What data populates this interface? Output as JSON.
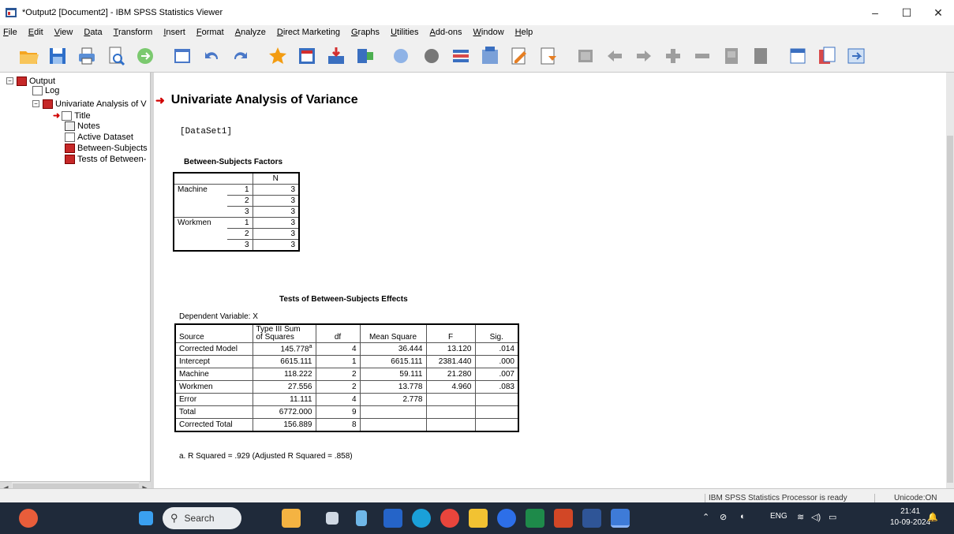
{
  "window": {
    "title": "*Output2 [Document2] - IBM SPSS Statistics Viewer",
    "controls": {
      "minimize": "–",
      "maximize": "☐",
      "close": "✕"
    }
  },
  "menu": [
    "File",
    "Edit",
    "View",
    "Data",
    "Transform",
    "Insert",
    "Format",
    "Analyze",
    "Direct Marketing",
    "Graphs",
    "Utilities",
    "Add-ons",
    "Window",
    "Help"
  ],
  "toolbar_icons": [
    "open-icon",
    "save-icon",
    "print-icon",
    "print-preview-icon",
    "export-icon",
    "recall-dialog-icon",
    "undo-icon",
    "redo-icon",
    "goto-data-icon",
    "goto-case-icon",
    "goto-variable-icon",
    "variables-icon",
    "create-title-icon",
    "create-text-icon",
    "insert-output-icon",
    "designate-window-icon",
    "promote-icon",
    "demote-icon",
    "collapse-icon",
    "back-icon",
    "forward-icon",
    "expand-icon",
    "minus-icon",
    "show-icon",
    "hide-icon",
    "insert-heading-icon",
    "insert-table-icon",
    "select-last-output-icon"
  ],
  "outline": {
    "root": "Output",
    "items": [
      {
        "label": "Log",
        "level": 1
      },
      {
        "label": "Univariate Analysis of V",
        "level": 1
      },
      {
        "label": "Title",
        "level": 2
      },
      {
        "label": "Notes",
        "level": 2
      },
      {
        "label": "Active Dataset",
        "level": 2
      },
      {
        "label": "Between-Subjects",
        "level": 2
      },
      {
        "label": "Tests of Between-",
        "level": 2
      }
    ]
  },
  "content": {
    "heading": "Univariate Analysis of Variance",
    "dataset": "[DataSet1]",
    "bsf": {
      "caption": "Between-Subjects Factors",
      "col_header": "N",
      "rows": [
        {
          "factor": "Machine",
          "level": "1",
          "n": "3"
        },
        {
          "factor": "",
          "level": "2",
          "n": "3"
        },
        {
          "factor": "",
          "level": "3",
          "n": "3"
        },
        {
          "factor": "Workmen",
          "level": "1",
          "n": "3"
        },
        {
          "factor": "",
          "level": "2",
          "n": "3"
        },
        {
          "factor": "",
          "level": "3",
          "n": "3"
        }
      ]
    },
    "tbse": {
      "caption": "Tests of Between-Subjects Effects",
      "depvar": "Dependent Variable:  X",
      "headers": [
        "Source",
        "Type III Sum of Squares",
        "df",
        "Mean Square",
        "F",
        "Sig."
      ],
      "header_ss_line1": "Type III Sum",
      "header_ss_line2": "of Squares",
      "rows": [
        {
          "source": "Corrected Model",
          "ss": "145.778",
          "sup": "a",
          "df": "4",
          "ms": "36.444",
          "f": "13.120",
          "sig": ".014"
        },
        {
          "source": "Intercept",
          "ss": "6615.111",
          "sup": "",
          "df": "1",
          "ms": "6615.111",
          "f": "2381.440",
          "sig": ".000"
        },
        {
          "source": "Machine",
          "ss": "118.222",
          "sup": "",
          "df": "2",
          "ms": "59.111",
          "f": "21.280",
          "sig": ".007"
        },
        {
          "source": "Workmen",
          "ss": "27.556",
          "sup": "",
          "df": "2",
          "ms": "13.778",
          "f": "4.960",
          "sig": ".083"
        },
        {
          "source": "Error",
          "ss": "11.111",
          "sup": "",
          "df": "4",
          "ms": "2.778",
          "f": "",
          "sig": ""
        },
        {
          "source": "Total",
          "ss": "6772.000",
          "sup": "",
          "df": "9",
          "ms": "",
          "f": "",
          "sig": ""
        },
        {
          "source": "Corrected Total",
          "ss": "156.889",
          "sup": "",
          "df": "8",
          "ms": "",
          "f": "",
          "sig": ""
        }
      ],
      "footnote": "a. R Squared = .929 (Adjusted R Squared = .858)"
    }
  },
  "status": {
    "processor": "IBM SPSS Statistics Processor is ready",
    "encoding": "Unicode:ON"
  },
  "taskbar": {
    "search_placeholder": "Search",
    "lang": "ENG",
    "time": "21:41",
    "date": "10-09-2024"
  }
}
